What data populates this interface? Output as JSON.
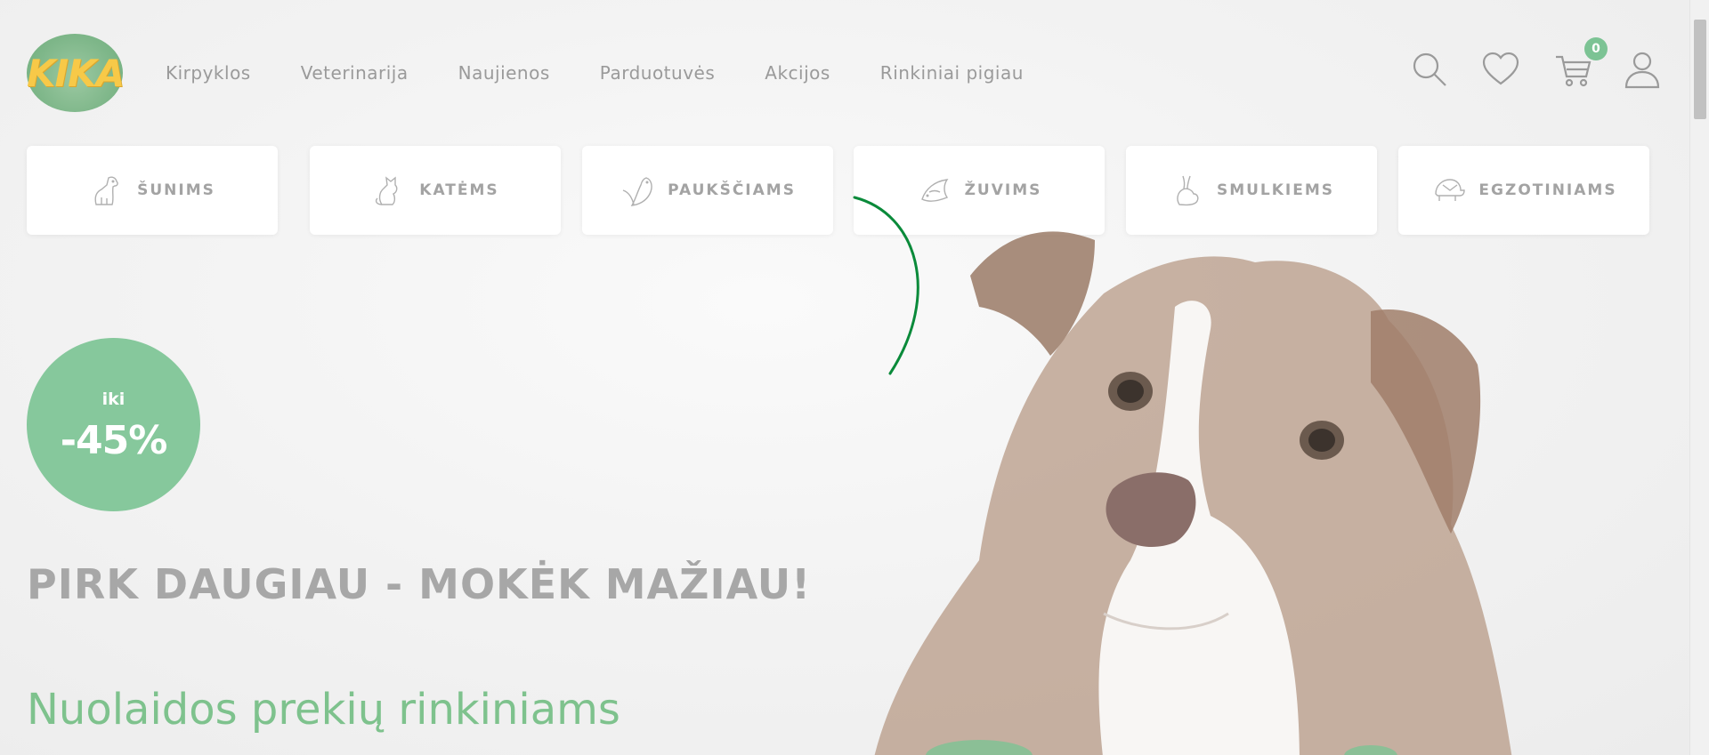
{
  "header": {
    "logo_text": "KIKA",
    "nav": [
      "Kirpyklos",
      "Veterinarija",
      "Naujienos",
      "Parduotuvės",
      "Akcijos",
      "Rinkiniai pigiau"
    ],
    "cart_count": "0"
  },
  "categories": [
    {
      "label": "ŠUNIMS",
      "icon": "dog-icon"
    },
    {
      "label": "KATĖMS",
      "icon": "cat-icon"
    },
    {
      "label": "PAUKŠČIAMS",
      "icon": "bird-icon"
    },
    {
      "label": "ŽUVIMS",
      "icon": "fish-icon"
    },
    {
      "label": "SMULKIEMS",
      "icon": "rabbit-icon"
    },
    {
      "label": "EGZOTINIAMS",
      "icon": "turtle-icon"
    }
  ],
  "hero": {
    "badge_prefix": "iki",
    "badge_value": "-45%",
    "headline": "PIRK DAUGIAU - MOKĖK MAŽIAU!",
    "subline": "Nuolaidos prekių rinkiniams"
  },
  "colors": {
    "accent_green": "#7ec28d",
    "badge_green": "#86c89c",
    "logo_yellow": "#f7c948",
    "loader_green": "#0a8a3a"
  }
}
